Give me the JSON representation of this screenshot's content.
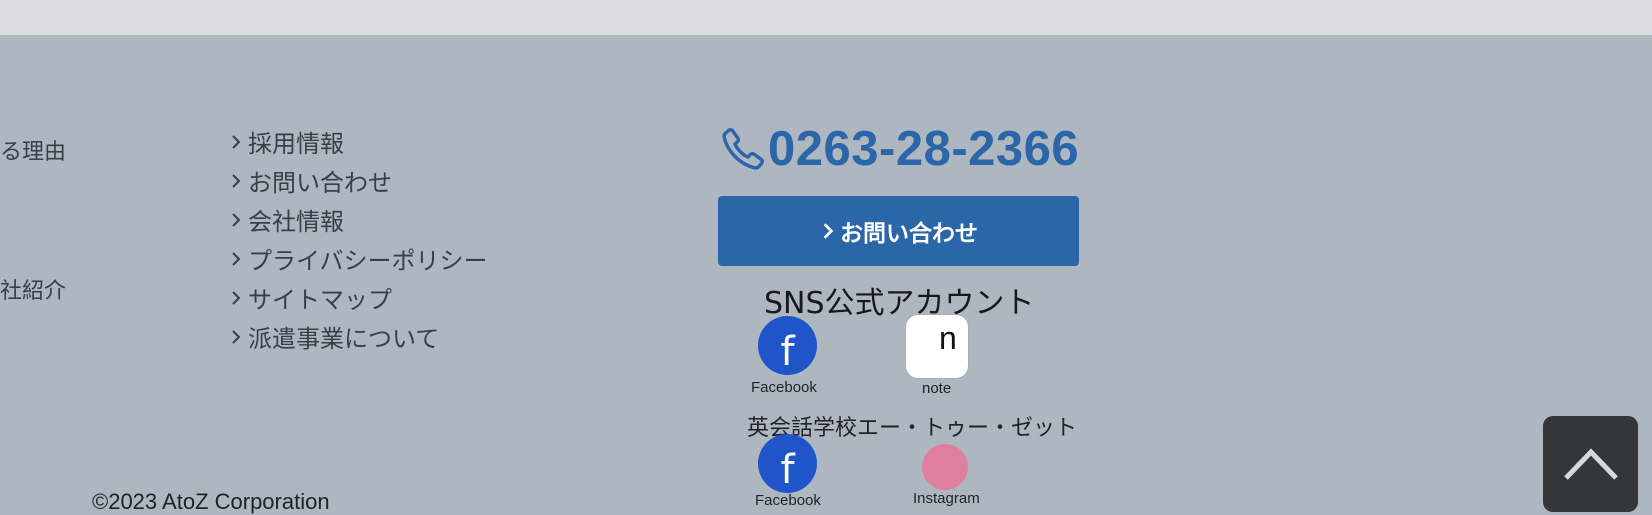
{
  "left_column": {
    "item1": "る理由",
    "item2": "社紹介"
  },
  "links": [
    {
      "label": "採用情報"
    },
    {
      "label": "お問い合わせ"
    },
    {
      "label": "会社情報"
    },
    {
      "label": "プライバシーポリシー"
    },
    {
      "label": "サイトマップ"
    },
    {
      "label": "派遣事業について"
    }
  ],
  "contact": {
    "phone_icon": "phone-icon",
    "phone": "0263-28-2366",
    "button_label": "お問い合わせ"
  },
  "sns": {
    "title": "SNS公式アカウント",
    "accounts": [
      {
        "icon": "facebook-icon",
        "glyph": "f",
        "label": "Facebook"
      },
      {
        "icon": "note-icon",
        "glyph": "n",
        "label": "note"
      }
    ],
    "school_title": "英会話学校エー・トゥー・ゼット",
    "school_accounts": [
      {
        "icon": "facebook-icon",
        "glyph": "f",
        "label": "Facebook"
      },
      {
        "icon": "instagram-icon",
        "label": "Instagram"
      }
    ]
  },
  "copyright": "©2023 AtoZ Corporation",
  "back_to_top": {
    "icon": "chevron-up-icon"
  },
  "colors": {
    "background": "#aeb6c0",
    "accent": "#2b66a8",
    "facebook": "#1f55c9",
    "instagram": "#e07ea0",
    "back_to_top": "#343739"
  }
}
